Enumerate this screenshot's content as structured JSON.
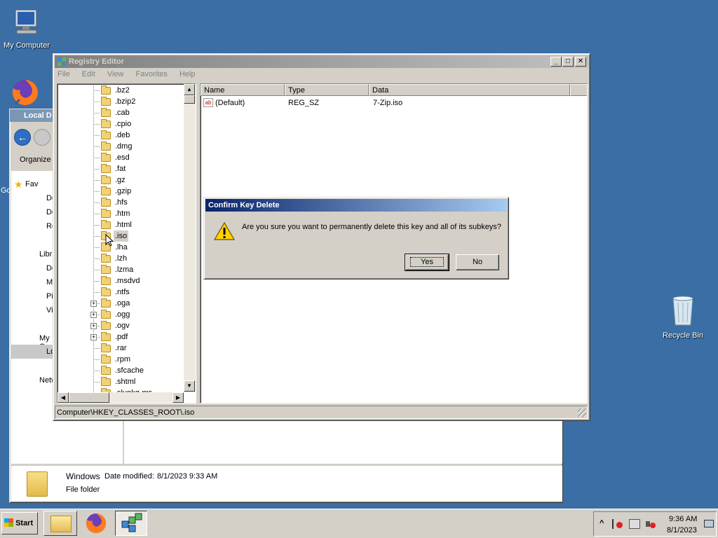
{
  "desktop": {
    "icons": [
      {
        "label": "My Computer"
      },
      {
        "label": "Recycle Bin"
      }
    ]
  },
  "explorer": {
    "title": "Local D",
    "organize": "Organize",
    "nav_items": [
      "Fav",
      "De",
      "Do",
      "Re",
      "Libra",
      "Do",
      "Mu",
      "Pi",
      "Vi",
      "My C",
      "Lo",
      "Netw"
    ],
    "left_edge_text": "Go",
    "details": {
      "name": "Windows",
      "modified_label": "Date modified:",
      "modified_value": "8/1/2023 9:33 AM",
      "type": "File folder"
    }
  },
  "regedit": {
    "title": "Registry Editor",
    "menu": [
      "File",
      "Edit",
      "View",
      "Favorites",
      "Help"
    ],
    "tree_keys": [
      ".bz2",
      ".bzip2",
      ".cab",
      ".cpio",
      ".deb",
      ".dmg",
      ".esd",
      ".fat",
      ".gz",
      ".gzip",
      ".hfs",
      ".htm",
      ".html",
      ".iso",
      ".lha",
      ".lzh",
      ".lzma",
      ".msdvd",
      ".ntfs",
      ".oga",
      ".ogg",
      ".ogv",
      ".pdf",
      ".rar",
      ".rpm",
      ".sfcache",
      ".shtml",
      ".slupkg-ms"
    ],
    "expandable_keys": [
      ".oga",
      ".ogg",
      ".ogv",
      ".pdf"
    ],
    "selected_key": ".iso",
    "columns": [
      "Name",
      "Type",
      "Data"
    ],
    "values": [
      {
        "name": "(Default)",
        "type": "REG_SZ",
        "data": "7-Zip.iso",
        "icon": "ab"
      }
    ],
    "status_path": "Computer\\HKEY_CLASSES_ROOT\\.iso"
  },
  "dialog": {
    "title": "Confirm Key Delete",
    "message": "Are you sure you want to permanently delete this key and all of its subkeys?",
    "yes": "Yes",
    "no": "No",
    "icon": "warning-icon"
  },
  "taskbar": {
    "start": "Start",
    "time": "9:36 AM",
    "date": "8/1/2023",
    "tray_arrow": "^"
  },
  "colors": {
    "desktop": "#3a6ea5",
    "active_title_start": "#0a246a",
    "active_title_end": "#a6caf0"
  }
}
